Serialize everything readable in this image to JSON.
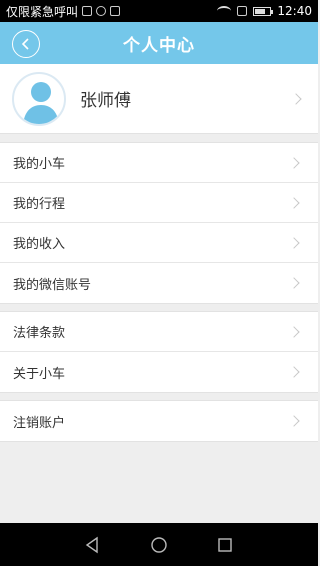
{
  "status_bar": {
    "left_text": "仅限紧急呼叫",
    "time": "12:40"
  },
  "header": {
    "title": "个人中心"
  },
  "profile": {
    "name": "张师傅"
  },
  "menu": {
    "group1": [
      {
        "label": "我的小车"
      },
      {
        "label": "我的行程"
      },
      {
        "label": "我的收入"
      },
      {
        "label": "我的微信账号"
      }
    ],
    "group2": [
      {
        "label": "法律条款"
      },
      {
        "label": "关于小车"
      }
    ],
    "group3": [
      {
        "label": "注销账户"
      }
    ]
  },
  "colors": {
    "header_bg": "#74c7ea",
    "avatar_fill": "#6fc1e6"
  }
}
